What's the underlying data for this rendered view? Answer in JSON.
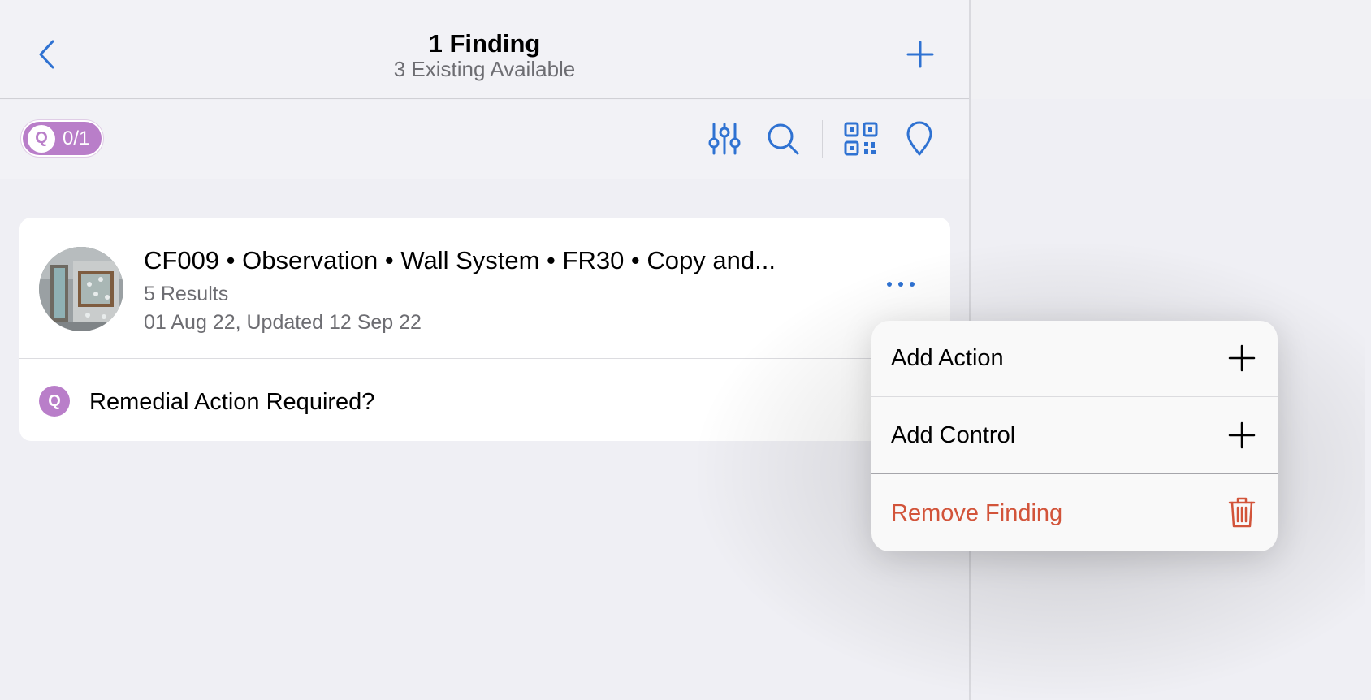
{
  "colors": {
    "accent": "#2f72d2",
    "question": "#b97ec9",
    "destructive": "#d2543a"
  },
  "navbar": {
    "title": "1 Finding",
    "subtitle": "3 Existing Available",
    "back_icon": "chevron-left-icon",
    "add_icon": "plus-icon"
  },
  "toolbar": {
    "question_badge": {
      "letter": "Q",
      "count": "0/1"
    },
    "icons": [
      "sliders-icon",
      "search-icon",
      "qr-code-icon",
      "location-pin-icon"
    ]
  },
  "finding": {
    "title": "CF009 • Observation • Wall System • FR30 • Copy and...",
    "results": "5 Results",
    "dates": "01 Aug 22, Updated 12 Sep 22",
    "more_icon": "more-horizontal-icon",
    "question": {
      "letter": "Q",
      "text": "Remedial Action Required?"
    }
  },
  "context_menu": {
    "items": [
      {
        "label": "Add Action",
        "icon": "plus-icon"
      },
      {
        "label": "Add Control",
        "icon": "plus-icon"
      },
      {
        "label": "Remove Finding",
        "icon": "trash-icon"
      }
    ]
  }
}
